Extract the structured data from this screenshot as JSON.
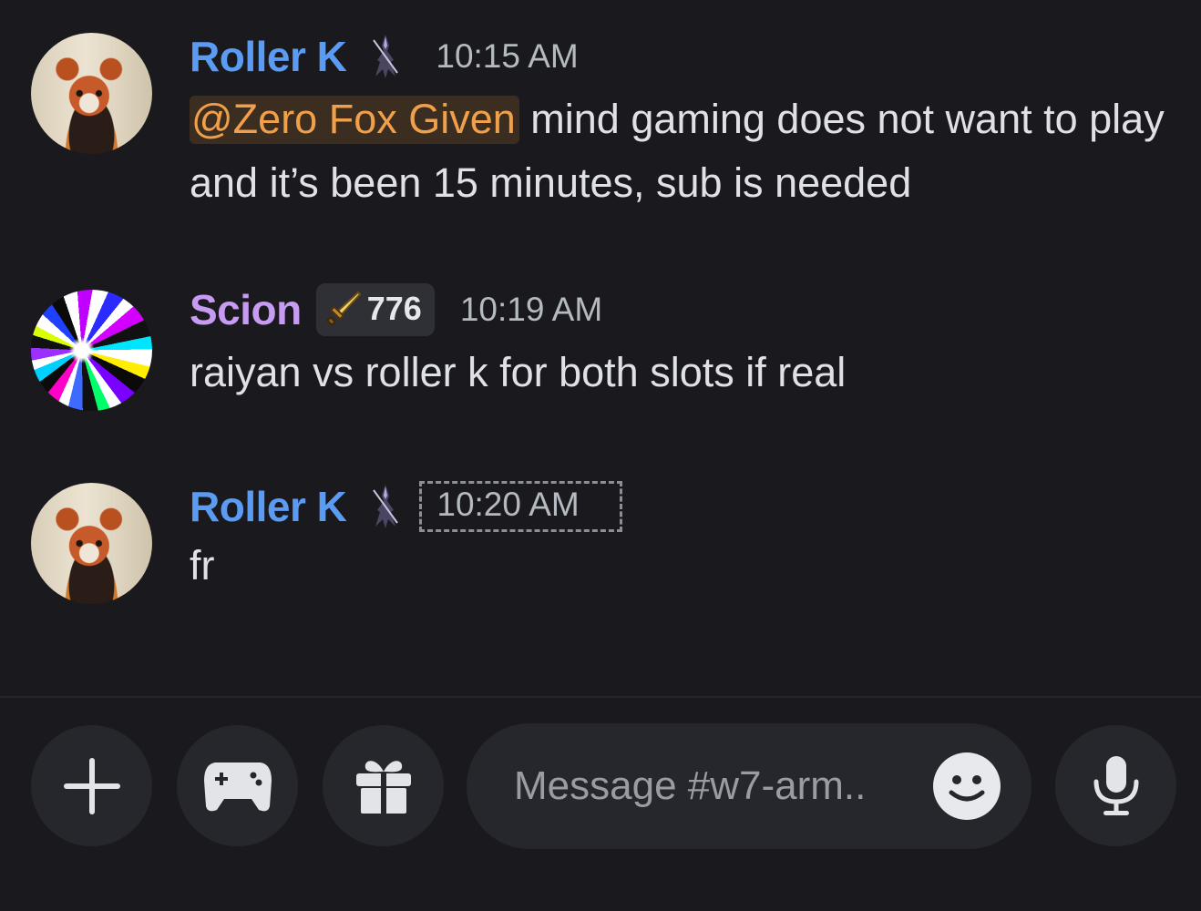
{
  "channel": {
    "input_placeholder": "Message #w7-arm.."
  },
  "messages": [
    {
      "author": "Roller K",
      "author_color": "#5b9bf2",
      "role_icon": "dark-knight-icon",
      "timestamp": "10:15 AM",
      "mention": "@Zero Fox Given",
      "text": " mind gaming does not want to play and it’s been 15 minutes, sub is needed"
    },
    {
      "author": "Scion",
      "author_color": "#c79bf2",
      "badge_icon": "golden-sword-icon",
      "badge_count": "776",
      "timestamp": "10:19 AM",
      "text": "raiyan vs roller k for both slots if real"
    },
    {
      "author": "Roller K",
      "author_color": "#5b9bf2",
      "role_icon": "dark-knight-icon",
      "timestamp": "10:20 AM",
      "text": "fr"
    }
  ],
  "composer": {
    "buttons": [
      "plus-icon",
      "gamepad-icon",
      "gift-icon",
      "emoji-icon",
      "microphone-icon"
    ]
  }
}
